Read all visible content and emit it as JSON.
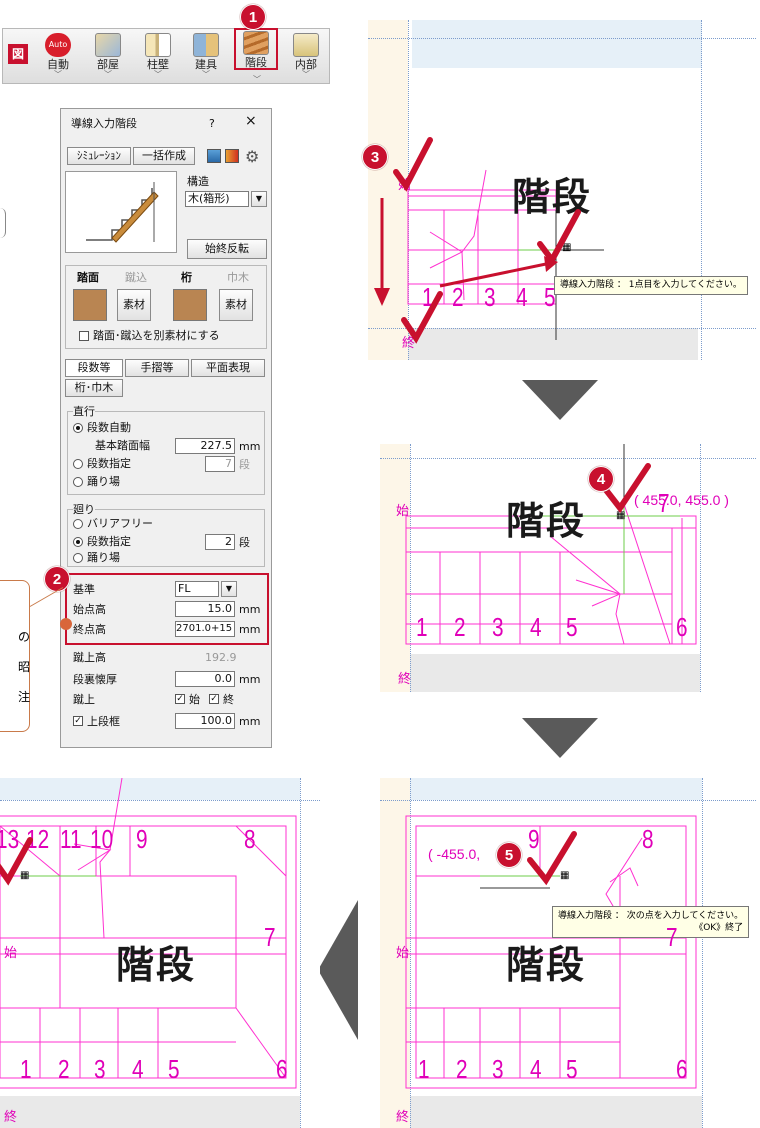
{
  "toolbar": {
    "items": [
      {
        "label": "図"
      },
      {
        "label": "自動",
        "badge": "Auto"
      },
      {
        "label": "部屋"
      },
      {
        "label": "柱壁"
      },
      {
        "label": "建具"
      },
      {
        "label": "階段"
      },
      {
        "label": "内部"
      }
    ]
  },
  "steps": [
    "1",
    "2",
    "3",
    "4",
    "5"
  ],
  "dialog": {
    "title": "導線入力階段",
    "help": "?",
    "close": "×",
    "tabs": {
      "sim": "ｼﾐｭﾚｰｼｮﾝ",
      "bulk": "一括作成"
    },
    "structure_label": "構造",
    "structure_value": "木(箱形)",
    "reverse_button": "始終反転",
    "materials": {
      "tread": "踏面",
      "riser": "蹴込",
      "stringer": "桁",
      "baseboard": "巾木",
      "material_btn": "素材"
    },
    "separate_check": "踏面･蹴込を別素材にする",
    "sections": {
      "steps": "段数等",
      "handrail": "手摺等",
      "plan": "平面表現",
      "stringer": "桁･巾木"
    },
    "straight": {
      "label": "直行",
      "auto": "段数自動",
      "base_width": "基本踏面幅",
      "base_width_value": "227.5",
      "unit_mm": "mm",
      "specify": "段数指定",
      "count_value": "7",
      "unit_dan": "段",
      "landing": "踊り場"
    },
    "turn": {
      "label": "廻り",
      "barrier": "バリアフリー",
      "specify": "段数指定",
      "count_value": "2",
      "unit_dan": "段",
      "landing": "踊り場"
    },
    "base": {
      "label": "基準",
      "value": "FL",
      "start_h": "始点高",
      "start_value": "15.0",
      "end_h": "終点高",
      "end_value": "2701.0+15",
      "unit_mm": "mm"
    },
    "riser_h": {
      "label": "蹴上高",
      "value": "192.9"
    },
    "back_thick": {
      "label": "段裏懐厚",
      "value": "0.0",
      "unit": "mm"
    },
    "riser_check": {
      "label": "蹴上",
      "start": "始",
      "end": "終"
    },
    "top_frame": {
      "label": "上段框",
      "value": "100.0",
      "unit": "mm"
    }
  },
  "callout": {
    "chars": [
      "の",
      "昭",
      "注"
    ]
  },
  "canvas": {
    "kaidan": "階段",
    "start": "始",
    "end": "終",
    "p1": {
      "numbers": [
        "1",
        "2",
        "3",
        "4",
        "5"
      ],
      "tooltip": "導線入力階段 ： 1点目を入力してください。"
    },
    "p2": {
      "numbers": [
        "1",
        "2",
        "3",
        "4",
        "5",
        "6",
        "7"
      ],
      "coord": "( 455.0, 455.0 )"
    },
    "p3": {
      "numbers": [
        "1",
        "2",
        "3",
        "4",
        "5",
        "6",
        "7",
        "8",
        "9"
      ],
      "coord": "( -455.0,",
      "tooltip_line1": "導線入力階段 ： 次の点を入力してください。",
      "tooltip_line2": "《OK》終了"
    },
    "p4": {
      "numbers": [
        "1",
        "2",
        "3",
        "4",
        "5",
        "6",
        "7",
        "8",
        "9",
        "10",
        "11",
        "12",
        "13"
      ]
    }
  },
  "colors": {
    "accent": "#c8102e",
    "magenta": "#e000b8",
    "check": "#c8102e"
  }
}
